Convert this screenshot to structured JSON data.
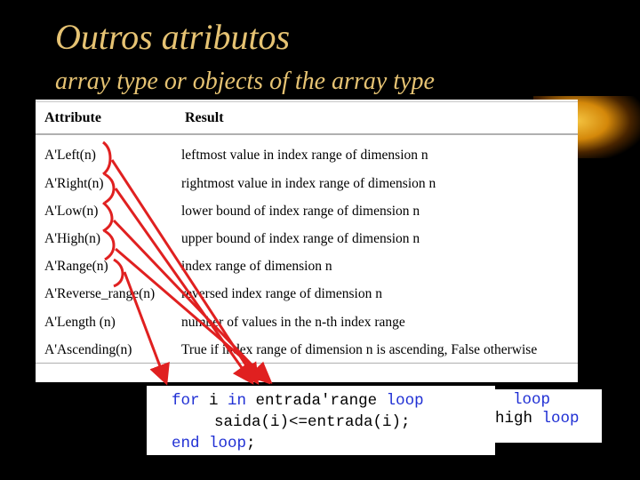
{
  "slide": {
    "title": "Outros atributos",
    "subtitle": "array type or objects of the array type",
    "colors": {
      "title": "#e6c373",
      "background": "#000000",
      "annotation": "#e02020",
      "keyword": "#1f2fd4"
    }
  },
  "table": {
    "headers": [
      "Attribute",
      "Result"
    ],
    "rows": [
      {
        "attribute": "A'Left(n)",
        "result": "leftmost value in index range of dimension n"
      },
      {
        "attribute": "A'Right(n)",
        "result": "rightmost value in index range of dimension n"
      },
      {
        "attribute": "A'Low(n)",
        "result": "lower bound of index range of dimension n"
      },
      {
        "attribute": "A'High(n)",
        "result": "upper bound of index range of dimension n"
      },
      {
        "attribute": "A'Range(n)",
        "result": "index range of dimension n"
      },
      {
        "attribute": "A'Reverse_range(n)",
        "result": "reversed index range of dimension n"
      },
      {
        "attribute": "A'Length (n)",
        "result": "number of values in the n-th index range"
      },
      {
        "attribute": "A'Ascending(n)",
        "result": "True if index range of dimension n is ascending, False otherwise"
      }
    ]
  },
  "code_main": {
    "line1": {
      "kw1": "for",
      "text1": " i ",
      "kw2": "in",
      "text2": " entrada'range ",
      "kw3": "loop"
    },
    "line2": {
      "text": "saida(i)<=entrada(i);"
    },
    "line3": {
      "kw1": "end",
      "kw2": "loop",
      "text": ";"
    }
  },
  "code_back": {
    "line1": {
      "kw": "loop"
    },
    "line2": {
      "text": "high ",
      "kw": "loop"
    }
  }
}
